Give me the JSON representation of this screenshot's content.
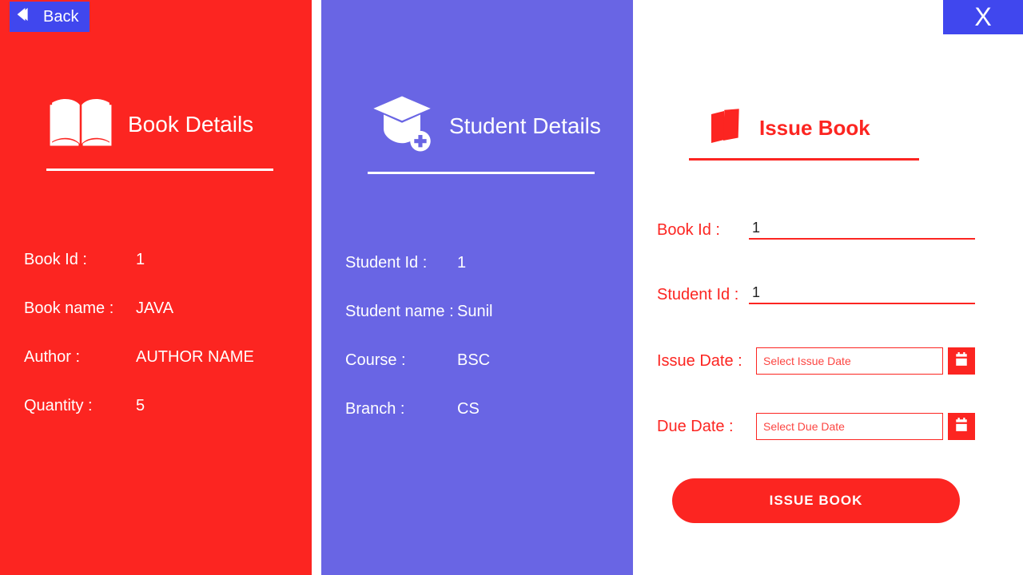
{
  "nav": {
    "back_label": "Back",
    "close_label": "X"
  },
  "book": {
    "title": "Book Details",
    "id_label": "Book Id :",
    "id_value": "1",
    "name_label": "Book name :",
    "name_value": "JAVA",
    "author_label": "Author :",
    "author_value": "AUTHOR NAME",
    "qty_label": "Quantity :",
    "qty_value": "5"
  },
  "student": {
    "title": "Student Details",
    "id_label": "Student Id :",
    "id_value": "1",
    "name_label": "Student name :",
    "name_value": "Sunil",
    "course_label": "Course :",
    "course_value": "BSC",
    "branch_label": "Branch :",
    "branch_value": "CS"
  },
  "issue": {
    "title": "Issue Book",
    "bookid_label": "Book Id  :",
    "bookid_value": "1",
    "studentid_label": "Student Id  :",
    "studentid_value": "1",
    "issuedate_label": "Issue Date  :",
    "issuedate_placeholder": "Select Issue Date",
    "duedate_label": "Due Date  :",
    "duedate_placeholder": "Select Due Date",
    "button_label": "ISSUE BOOK"
  }
}
